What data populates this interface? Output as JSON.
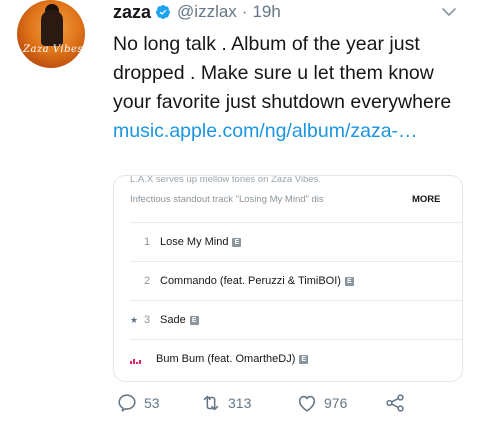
{
  "tweet": {
    "display_name": "zaza",
    "handle": "@izzlax",
    "separator": "·",
    "time": "19h",
    "text": "No long talk . Album of the year just dropped . Make sure u let them know your favorite just shutdown everywhere ",
    "link_text": "music.apple.com/ng/album/zaza-…",
    "avatar_text": "Zaza Vibes"
  },
  "card": {
    "description_line1": "L.A.X serves up mellow tones on Zaza Vibes.",
    "description_line2": "Infectious standout track \"Losing My Mind\" dis",
    "more_label": "MORE",
    "tracks": [
      {
        "number": "1",
        "title": "Lose My Mind",
        "explicit": "E",
        "starred": false,
        "playing": false
      },
      {
        "number": "2",
        "title": "Commando (feat. Peruzzi & TimiBOI)",
        "explicit": "E",
        "starred": false,
        "playing": false
      },
      {
        "number": "3",
        "title": "Sade",
        "explicit": "E",
        "starred": true,
        "playing": false
      },
      {
        "number": "",
        "title": "Bum Bum (feat. OmartheDJ)",
        "explicit": "E",
        "starred": false,
        "playing": true
      }
    ]
  },
  "actions": {
    "reply_count": "53",
    "retweet_count": "313",
    "like_count": "976"
  },
  "colors": {
    "link": "#1b95e0",
    "verified": "#1da1f2",
    "muted": "#657786",
    "playing": "#e0245e"
  }
}
